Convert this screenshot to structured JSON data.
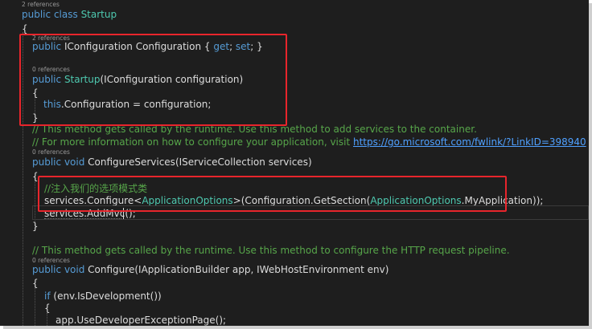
{
  "code": {
    "lens_2_refs": "2 references",
    "lens_0_refs": "0 references",
    "kw_public": "public",
    "kw_class": "class",
    "kw_void": "void",
    "kw_this": "this",
    "kw_if": "if",
    "kw_get": "get",
    "kw_set": "set",
    "class_name": "Startup",
    "type_iconfiguration": "IConfiguration",
    "type_iservicecollection": "IServiceCollection",
    "type_iapplicationbuilder": "IApplicationBuilder",
    "type_iwebhostenvironment": "IWebHostEnvironment",
    "type_applicationoptions": "ApplicationOptions",
    "prop_configuration": "Configuration",
    "param_configuration": "configuration",
    "param_services": "services",
    "param_app": "app",
    "param_env": "env",
    "method_configureservices": "ConfigureServices",
    "method_configure": "Configure",
    "method_configure_generic": "Configure",
    "method_getsection": "GetSection",
    "member_myapplication": "MyApplication",
    "member_adddvc": "AddMvc",
    "member_isdevelopment": "IsDevelopment",
    "member_usedeveloperexceptionpage": "UseDeveloperExceptionPage",
    "comment_services_1": "// This method gets called by the runtime. Use this method to add services to the container.",
    "comment_services_2_prefix": "// For more information on how to configure your application, visit ",
    "comment_link": "https://go.microsoft.com/fwlink/?LinkID=398940",
    "comment_chinese": "//注入我们的选项模式类",
    "comment_configure": "// This method gets called by the runtime. Use this method to configure the HTTP request pipeline."
  },
  "colors": {
    "background": "#1e1e1e",
    "keyword": "#569cd6",
    "type": "#4ec9b0",
    "text": "#dcdcdc",
    "comment": "#57a64a",
    "link": "#4fa0ff",
    "annotation_box": "#e8252c"
  }
}
